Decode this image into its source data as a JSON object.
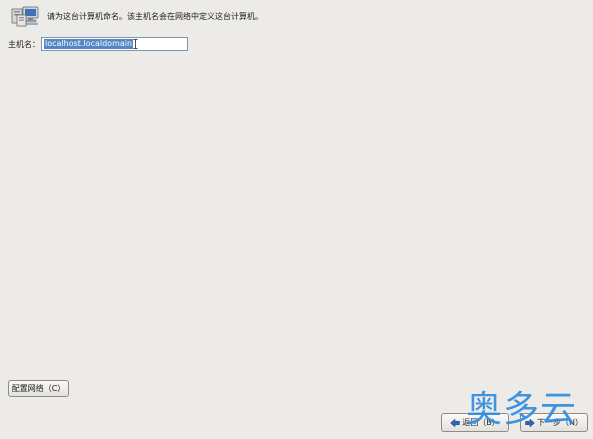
{
  "header": {
    "instruction": "请为这台计算机命名。该主机名会在网络中定义这台计算机。",
    "icon": "network-computers-icon"
  },
  "hostname": {
    "label": "主机名：",
    "value": "localhost.localdomain"
  },
  "buttons": {
    "configure_network": "配置网络（C）",
    "back": "返回（B）",
    "next": "下一步（N）"
  },
  "watermark": {
    "text": "奥多云"
  },
  "colors": {
    "background": "#edebe8",
    "selection": "#5586c4",
    "input_border": "#7c95b9",
    "watermark": "#2d8ce0"
  }
}
